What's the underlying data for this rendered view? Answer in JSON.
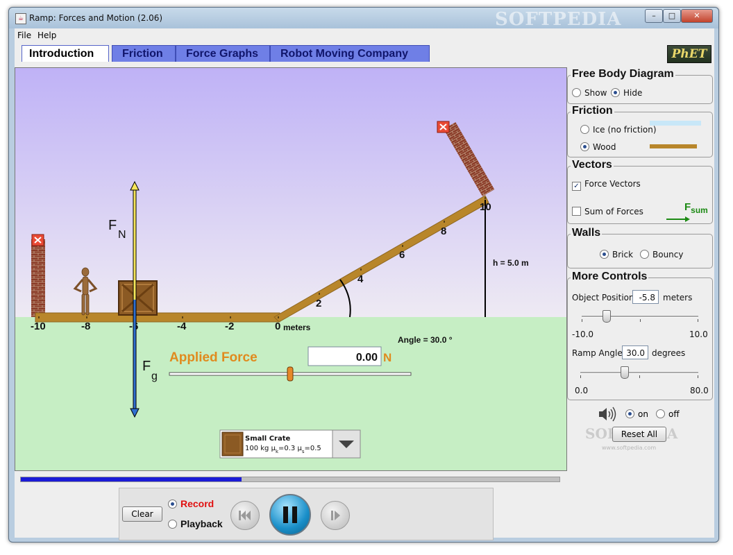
{
  "window": {
    "title": "Ramp: Forces and Motion (2.06)",
    "watermark": "SOFTPEDIA",
    "minimize": "–",
    "maximize": "□",
    "close": "✕"
  },
  "menu": {
    "file": "File",
    "help": "Help"
  },
  "tabs": [
    {
      "label": "Introduction",
      "active": true
    },
    {
      "label": "Friction"
    },
    {
      "label": "Force Graphs"
    },
    {
      "label": "Robot Moving Company"
    }
  ],
  "logo": "PhET",
  "scene": {
    "axis_ticks": [
      "-10",
      "-8",
      "-6",
      "-4",
      "-2",
      "0",
      "2",
      "4",
      "6",
      "8",
      "10"
    ],
    "axis_unit": "meters",
    "height_label": "h = 5.0 m",
    "angle_label": "Angle = 30.0 °",
    "normal_force_label": "F",
    "normal_force_sub": "N",
    "gravity_force_label": "F",
    "gravity_force_sub": "g",
    "applied_force_label": "Applied Force",
    "applied_force_value": "0.00",
    "applied_force_unit": "N",
    "applied_force_slider_fraction": 0.5,
    "object_select": {
      "name": "Small Crate",
      "detail": "100 kg μk=0.3 μs=0.5",
      "mass": "100 kg μ",
      "mu_k_sub": "k",
      "mu_k_val": "=0.3 μ",
      "mu_s_sub": "s",
      "mu_s_val": "=0.5"
    }
  },
  "panels": {
    "fbd": {
      "title": "Free Body Diagram",
      "show": "Show",
      "hide": "Hide",
      "selected": "Hide"
    },
    "friction": {
      "title": "Friction",
      "ice": "Ice (no friction)",
      "wood": "Wood",
      "selected": "Wood"
    },
    "vectors": {
      "title": "Vectors",
      "force_vectors": "Force Vectors",
      "force_vectors_checked": true,
      "sum_of_forces": "Sum of Forces",
      "sum_of_forces_checked": false,
      "fsum_label": "F",
      "fsum_sub": "sum"
    },
    "walls": {
      "title": "Walls",
      "brick": "Brick",
      "bouncy": "Bouncy",
      "selected": "Brick"
    },
    "more": {
      "title": "More Controls",
      "object_position_label": "Object Position",
      "object_position_value": "-5.8",
      "object_position_unit": "meters",
      "position_min": "-10.0",
      "position_max": "10.0",
      "ramp_angle_label": "Ramp Angle",
      "ramp_angle_value": "30.0",
      "ramp_angle_unit": "degrees",
      "angle_min": "0.0",
      "angle_max": "80.0"
    }
  },
  "sound": {
    "on": "on",
    "off": "off",
    "selected": "on"
  },
  "reset_all": "Reset All",
  "bottom_watermark": "SOFTPEDIA",
  "bottom_watermark_url": "www.softpedia.com",
  "record": {
    "clear": "Clear",
    "record": "Record",
    "playback": "Playback",
    "selected": "Record",
    "progress_fraction": 0.41
  },
  "colors": {
    "sky_top": "#bfb2f6",
    "sky_bottom": "#eeeaf3",
    "ground": "#c6eec4",
    "ramp": "#b8862b",
    "tab_active": "#ffffff",
    "tab_inactive": "#6f7fe6",
    "record_red": "#e01010",
    "applied_force": "#e08a1e",
    "normal_force": "#f6e65a",
    "gravity_force": "#2f6fd0"
  }
}
